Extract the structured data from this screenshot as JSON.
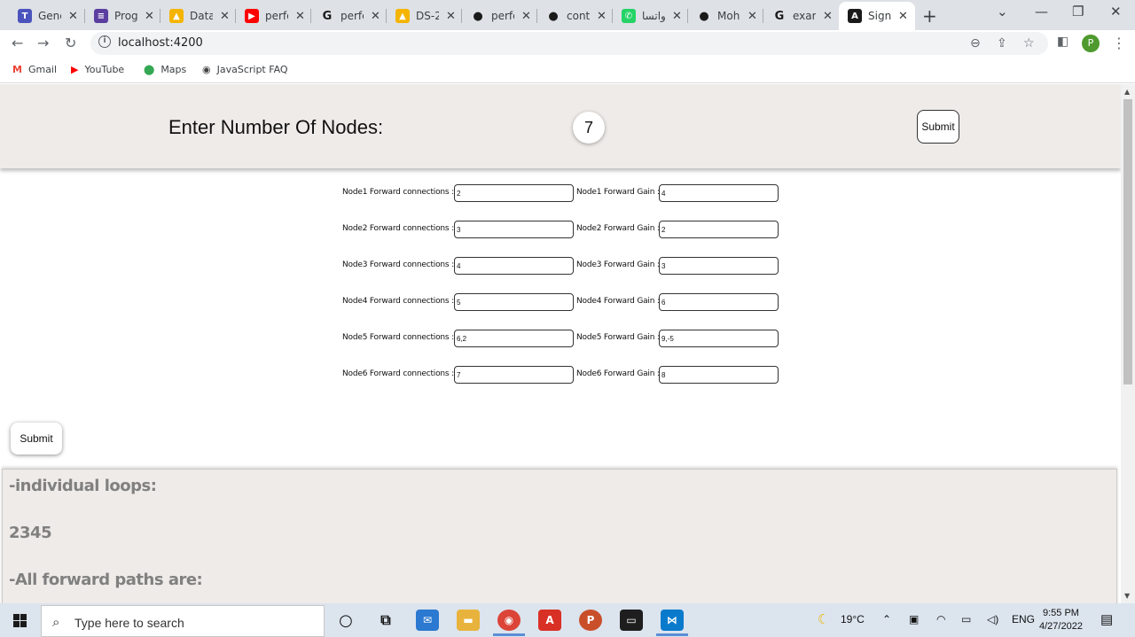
{
  "browser": {
    "tabs": [
      {
        "title": "General",
        "icon_color": "#4b53bc",
        "icon": "T"
      },
      {
        "title": "Programs",
        "icon_color": "#5b3fa0",
        "icon": "≡"
      },
      {
        "title": "Data",
        "icon_color": "#f4b400",
        "icon": "▲"
      },
      {
        "title": "perfect",
        "icon_color": "#ff0000",
        "icon": "▶"
      },
      {
        "title": "perfect",
        "icon_color": "#ffffff",
        "icon": "G"
      },
      {
        "title": "DS-2",
        "icon_color": "#f4b400",
        "icon": "▲"
      },
      {
        "title": "perfect",
        "icon_color": "#ffffff",
        "icon": "●"
      },
      {
        "title": "contr",
        "icon_color": "#ffffff",
        "icon": "●"
      },
      {
        "title": "واتسا",
        "icon_color": "#25d366",
        "icon": "✆"
      },
      {
        "title": "Moh",
        "icon_color": "#ffffff",
        "icon": "●"
      },
      {
        "title": "exam",
        "icon_color": "#ffffff",
        "icon": "G"
      },
      {
        "title": "Sign",
        "icon_color": "#1a1a1a",
        "icon": "A"
      }
    ],
    "url": "localhost:4200",
    "bookmarks": [
      {
        "label": "Gmail",
        "icon": "M",
        "color": "#ea4335"
      },
      {
        "label": "YouTube",
        "icon": "▶",
        "color": "#ff0000"
      },
      {
        "label": "Maps",
        "icon": "⬤",
        "color": "#34a853"
      },
      {
        "label": "JavaScript FAQ",
        "icon": "◉",
        "color": "#444444"
      }
    ],
    "profile_initial": "P"
  },
  "app": {
    "header": {
      "title": "Enter Number Of Nodes:",
      "node_count": "7",
      "submit_label": "Submit"
    },
    "nodes": [
      {
        "conn_label": "Node1 Forward connections :",
        "conn_value": "2",
        "gain_label": "Node1 Forward Gain :",
        "gain_value": "4"
      },
      {
        "conn_label": "Node2 Forward connections :",
        "conn_value": "3",
        "gain_label": "Node2 Forward Gain :",
        "gain_value": "2"
      },
      {
        "conn_label": "Node3 Forward connections :",
        "conn_value": "4",
        "gain_label": "Node3 Forward Gain :",
        "gain_value": "3"
      },
      {
        "conn_label": "Node4 Forward connections :",
        "conn_value": "5",
        "gain_label": "Node4 Forward Gain :",
        "gain_value": "6"
      },
      {
        "conn_label": "Node5 Forward connections :",
        "conn_value": "6,2",
        "gain_label": "Node5 Forward Gain :",
        "gain_value": "9,-5"
      },
      {
        "conn_label": "Node6 Forward connections :",
        "conn_value": "7",
        "gain_label": "Node6 Forward Gain :",
        "gain_value": "8"
      }
    ],
    "submit_label": "Submit",
    "results": {
      "loops_heading": "-individual loops:",
      "loops_value": "2345",
      "paths_heading": "-All forward paths are:"
    }
  },
  "taskbar": {
    "search_placeholder": "Type here to search",
    "weather": "19°C",
    "language": "ENG",
    "time": "9:55 PM",
    "date": "4/27/2022"
  }
}
